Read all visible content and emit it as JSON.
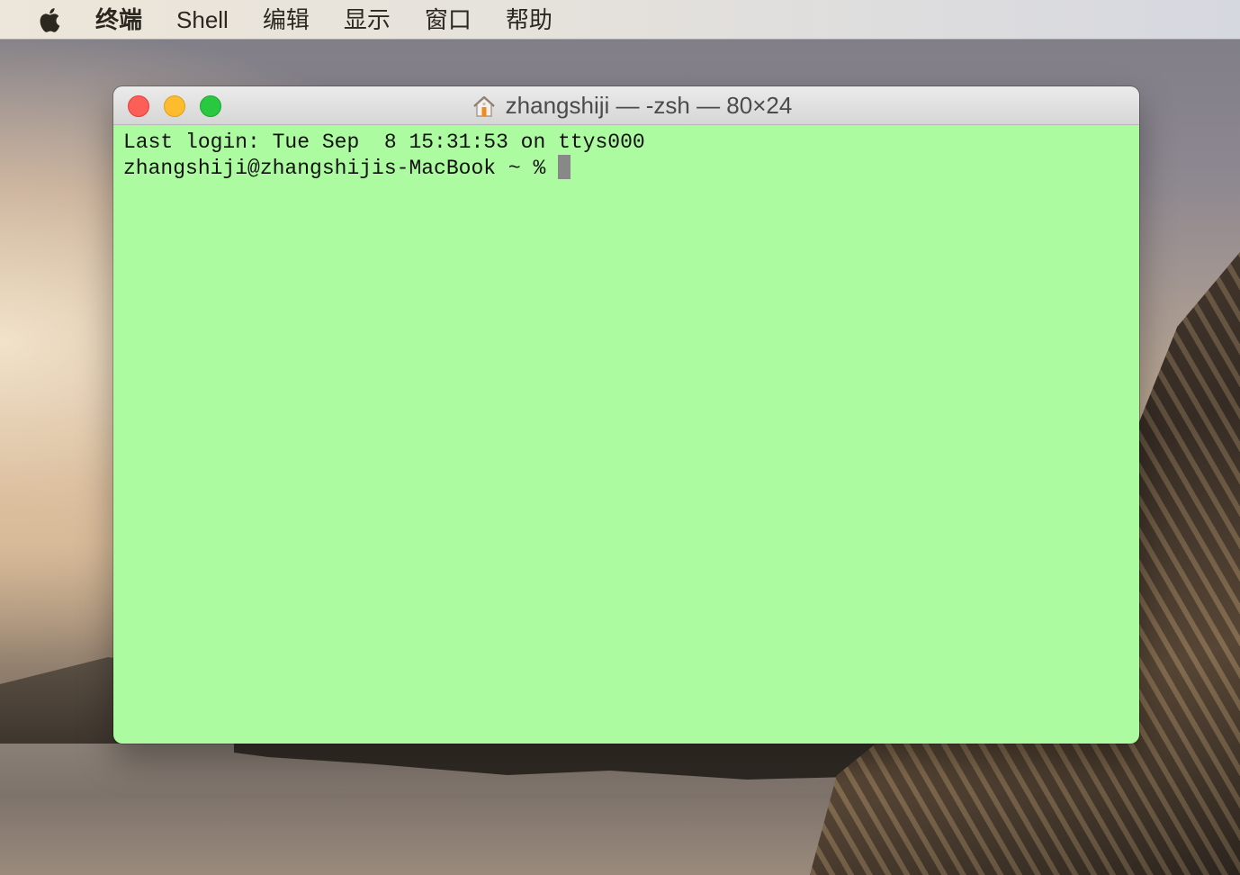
{
  "menubar": {
    "apple_icon": "apple-logo-icon",
    "items": [
      {
        "label": "终端",
        "bold": true
      },
      {
        "label": "Shell"
      },
      {
        "label": "编辑"
      },
      {
        "label": "显示"
      },
      {
        "label": "窗口"
      },
      {
        "label": "帮助"
      }
    ]
  },
  "window": {
    "title_icon": "home-folder-icon",
    "title": "zhangshiji — -zsh — 80×24",
    "buttons": {
      "close": "close",
      "minimize": "minimize",
      "zoom": "zoom"
    },
    "colors": {
      "background": "#adfba0",
      "text": "#111111",
      "cursor": "#888888"
    }
  },
  "terminal": {
    "lines": [
      "Last login: Tue Sep  8 15:31:53 on ttys000",
      "zhangshiji@zhangshijis-MacBook ~ %"
    ]
  }
}
